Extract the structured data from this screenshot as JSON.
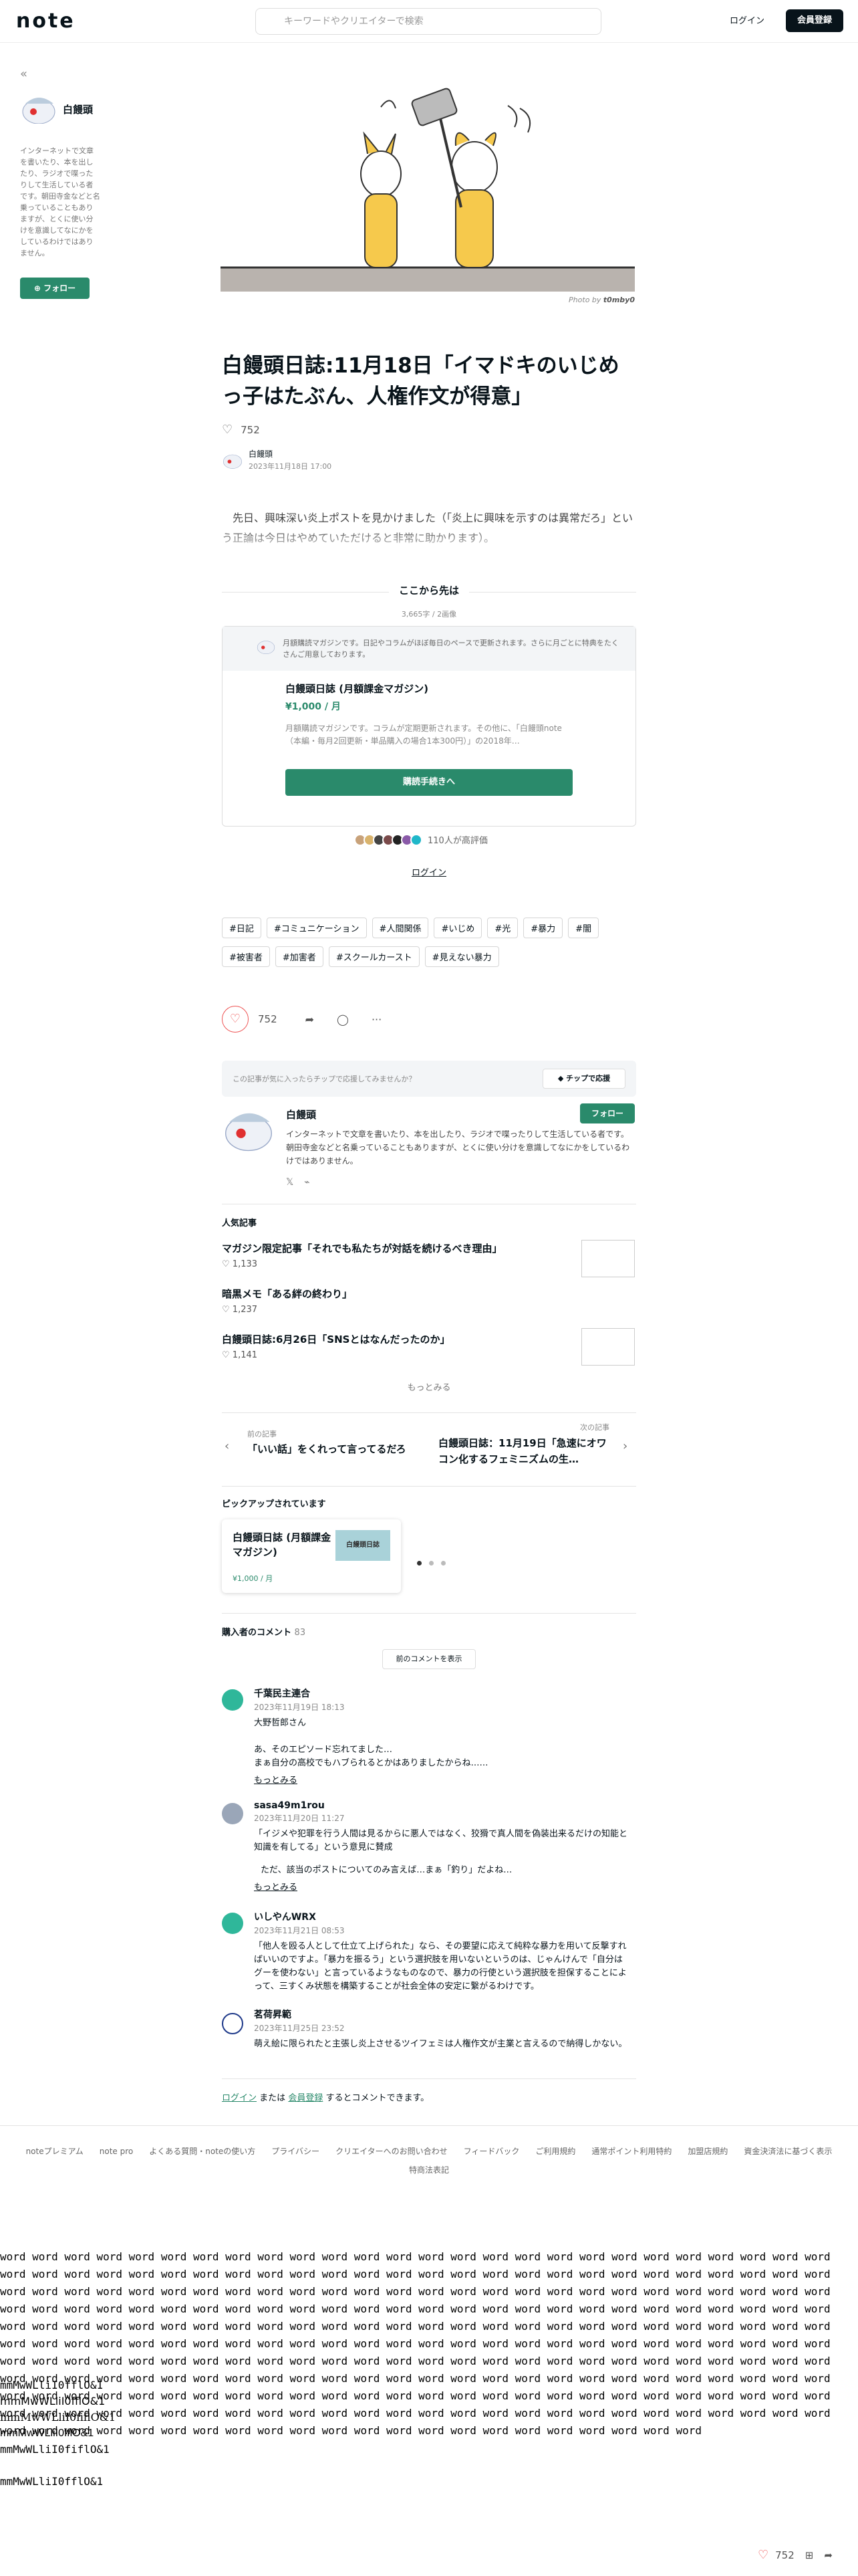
{
  "header": {
    "logo": "note",
    "search_placeholder": "キーワードやクリエイターで検索",
    "login": "ログイン",
    "signup": "会員登録"
  },
  "sidebar": {
    "author": "白饅頭",
    "bio": "インターネットで文章を書いたり、本を出したり、ラジオで喋ったりして生活している者です。朝田寺金などと名乗っていることもありますが、とくに使い分けを意識してなにかをしているわけではありません。",
    "follow": "フォロー"
  },
  "article": {
    "photo_credit_prefix": "Photo by",
    "photo_credit_name": "t0mby0",
    "title": "白饅頭日誌:11月18日「イマドキのいじめっ子はたぶん、人権作文が得意」",
    "likes": "752",
    "author": "白饅頭",
    "date": "2023年11月18日 17:00",
    "intro": "先日、興味深い炎上ポストを見かけました（「炎上に興味を示すのは異常だろ」という正論は今日はやめていただけると非常に助かります）。"
  },
  "paywall": {
    "heading": "ここから先は",
    "meta": "3,665字 / 2画像",
    "notice": "月額購読マガジンです。日記やコラムがほぼ毎日のペースで更新されます。さらに月ごとに特典をたくさんご用意しております。",
    "magazine_title": "白饅頭日誌 (月額課金マガジン)",
    "price": "¥1,000 / 月",
    "description": "月額購読マガジンです。コラムが定期更新されます。その他に、「白饅頭note（本編・毎月2回更新・単品購入の場合1本300円）」の2018年…",
    "buy": "購読手続きへ",
    "supporters": "110人が高評価",
    "login": "ログイン"
  },
  "tags": [
    "#日記",
    "#コミュニケーション",
    "#人間関係",
    "#いじめ",
    "#光",
    "#暴力",
    "#闇",
    "#被害者",
    "#加害者",
    "#スクールカースト",
    "#見えない暴力"
  ],
  "actions": {
    "likes": "752"
  },
  "tip": {
    "prompt": "この記事が気に入ったらチップで応援してみませんか？",
    "button": "チップで応援"
  },
  "profile": {
    "name": "白饅頭",
    "follow": "フォロー",
    "bio": "インターネットで文章を書いたり、本を出したり、ラジオで喋ったりして生活している者です。朝田寺金などと名乗っていることもありますが、とくに使い分けを意識してなにかをしているわけではありません。"
  },
  "popular": {
    "heading": "人気記事",
    "items": [
      {
        "title": "マガジン限定記事「それでも私たちが対話を続けるべき理由」",
        "likes": "1,133"
      },
      {
        "title": "暗黒メモ「ある絆の終わり」",
        "likes": "1,237"
      },
      {
        "title": "白饅頭日誌:6月26日「SNSとはなんだったのか」",
        "likes": "1,141"
      }
    ],
    "more": "もっとみる"
  },
  "nav": {
    "prev_label": "前の記事",
    "prev_title": "「いい話」をくれって言ってるだろ",
    "next_label": "次の記事",
    "next_title": "白饅頭日誌：11月19日「急速にオワコン化するフェミニズムの生…"
  },
  "pickup": {
    "heading": "ピックアップされています",
    "title": "白饅頭日誌 (月額課金マガジン)",
    "price": "¥1,000 / 月",
    "thumb_text": "白饅頭日誌"
  },
  "comments": {
    "heading": "購入者のコメント",
    "count": "83",
    "prev": "前のコメントを表示",
    "items": [
      {
        "name": "千葉民主連合",
        "date": "2023年11月19日 18:13",
        "body1": "大野哲郎さん",
        "body2": "あ、そのエピソード忘れてました…\nまぁ自分の高校でもハブられるとかはありましたからね……",
        "more": "もっとみる",
        "color": "#2fb79a"
      },
      {
        "name": "sasa49m1rou",
        "date": "2023年11月20日 11:27",
        "body1": "「イジメや犯罪を行う人間は見るからに悪人ではなく、狡猾で真人間を偽装出来るだけの知能と知識を有してる」という意見に賛成",
        "body2": "ただ、該当のポストについてのみ言えば…まぁ「釣り」だよね…",
        "more": "もっとみる",
        "color": "#9aa6b8"
      },
      {
        "name": "いしやんWRX",
        "date": "2023年11月21日 08:53",
        "body1": "「他人を殴る人として仕立て上げられた」なら、その要望に応えて純粋な暴力を用いて反撃すればいいのですよ。「暴力を振るう」という選択肢を用いないというのは、じゃんけんで「自分はグーを使わない」と言っているようなものなので、暴力の行使という選択肢を担保することによって、三すくみ状態を構築することが社会全体の安定に繋がるわけです。",
        "body2": "",
        "more": "",
        "color": "#2fb79a"
      },
      {
        "name": "茗荷昇範",
        "date": "2023年11月25日 23:52",
        "body1": "萌え絵に限られたと主張し炎上させるツイフェミは人権作文が主業と言えるので納得しかない。",
        "body2": "",
        "more": "",
        "color": "#1f3a8a"
      }
    ],
    "login_link": "ログイン",
    "or": "または",
    "signup_link": "会員登録",
    "tail": "するとコメントできます。"
  },
  "footer": {
    "links": [
      "noteプレミアム",
      "note pro",
      "よくある質問・noteの使い方",
      "プライバシー",
      "クリエイターへのお問い合わせ",
      "フィードバック",
      "ご利用規約",
      "通常ポイント利用特約",
      "加盟店規約",
      "資金決済法に基づく表示"
    ],
    "links2": [
      "特商法表記"
    ]
  },
  "filler": {
    "words": "word word word word word word word word word word word word word word word word word word word word word word word word word word word word word word word word word word word word word word word word word word word word word word word word word word word word word word word word word word word word word word word word word word word word word word word word word word word word word word word word word word word word word word word word word word word word word word word word word word word word word word word word word word word word word word word word word word word word word word word word word word word word word word word word word word word word word word word word word word word word word word word word word word word word word word word word word word word word word word word word word word word word word word word word word word word word word word word word word word word word word word word word word word word word word word word word word word word word word word word word word word word word word word word word word word word word word word word word word word word word word word word word word word word word word word word word word word word word word word word word word word word word word word word word word word word word word word word word word word word word word word word word word word word word word word word word word word word word word word word word word word",
    "l1": "mmMwWLliI0fflO&1",
    "l2": "mmMwWLliI0fflO&1",
    "l3": "mmMwWLliI0fiflO&1",
    "l4": "mmMwWLliI0fflO&1",
    "l5": "mmMwWLliI0fiflO&1",
    "l6": "mmMwWLliI0fflO&1"
  },
  "bottom_bar": {
    "likes": "752"
  }
}
